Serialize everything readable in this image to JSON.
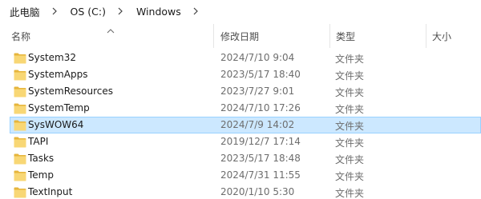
{
  "breadcrumb": [
    {
      "label": "此电脑"
    },
    {
      "label": "OS (C:)"
    },
    {
      "label": "Windows"
    }
  ],
  "columns": {
    "name": "名称",
    "date": "修改日期",
    "type": "类型",
    "size": "大小"
  },
  "sort": {
    "column": "name",
    "direction": "ascending"
  },
  "colors": {
    "selection_bg": "#cce8ff",
    "selection_border": "#99d1ff",
    "folder_yellow": "#f8d775",
    "folder_dark": "#e6b53c"
  },
  "files": [
    {
      "name": "System32",
      "date": "2024/7/10 9:04",
      "type": "文件夹",
      "icon": "folder-icon",
      "selected": false
    },
    {
      "name": "SystemApps",
      "date": "2023/5/17 18:40",
      "type": "文件夹",
      "icon": "folder-icon",
      "selected": false
    },
    {
      "name": "SystemResources",
      "date": "2023/7/27 9:01",
      "type": "文件夹",
      "icon": "folder-icon",
      "selected": false
    },
    {
      "name": "SystemTemp",
      "date": "2024/7/10 17:26",
      "type": "文件夹",
      "icon": "folder-icon",
      "selected": false
    },
    {
      "name": "SysWOW64",
      "date": "2024/7/9 14:02",
      "type": "文件夹",
      "icon": "folder-icon",
      "selected": true
    },
    {
      "name": "TAPI",
      "date": "2019/12/7 17:14",
      "type": "文件夹",
      "icon": "folder-icon",
      "selected": false
    },
    {
      "name": "Tasks",
      "date": "2023/5/17 18:48",
      "type": "文件夹",
      "icon": "folder-icon",
      "selected": false
    },
    {
      "name": "Temp",
      "date": "2024/7/31 11:55",
      "type": "文件夹",
      "icon": "folder-icon",
      "selected": false
    },
    {
      "name": "TextInput",
      "date": "2020/1/10 5:30",
      "type": "文件夹",
      "icon": "folder-icon",
      "selected": false
    }
  ]
}
